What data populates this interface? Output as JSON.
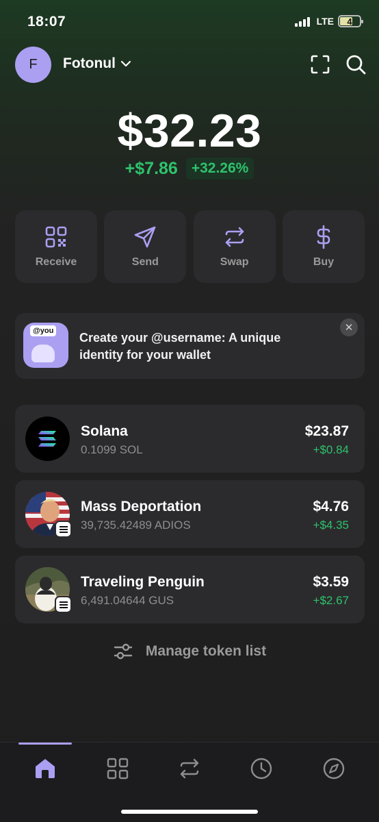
{
  "status_bar": {
    "time": "18:07",
    "network": "LTE",
    "battery": "4"
  },
  "header": {
    "avatar_letter": "F",
    "account_name": "Fotonul"
  },
  "balance": {
    "total": "$32.23",
    "change_abs": "+$7.86",
    "change_pct": "+32.26%"
  },
  "actions": [
    {
      "label": "Receive",
      "icon": "qr-code-icon"
    },
    {
      "label": "Send",
      "icon": "send-icon"
    },
    {
      "label": "Swap",
      "icon": "swap-icon"
    },
    {
      "label": "Buy",
      "icon": "dollar-icon"
    }
  ],
  "promo": {
    "tag": "@you",
    "text": "Create your @username: A unique identity for your wallet"
  },
  "tokens": [
    {
      "name": "Solana",
      "amount": "0.1099 SOL",
      "value": "$23.87",
      "change": "+$0.84"
    },
    {
      "name": "Mass Deportation",
      "amount": "39,735.42489 ADIOS",
      "value": "$4.76",
      "change": "+$4.35"
    },
    {
      "name": "Traveling Penguin",
      "amount": "6,491.04644 GUS",
      "value": "$3.59",
      "change": "+$2.67"
    }
  ],
  "manage": {
    "label": "Manage token list"
  },
  "tabs": [
    "home-icon",
    "grid-icon",
    "swap-icon",
    "history-icon",
    "explore-icon"
  ],
  "colors": {
    "accent": "#ab9ff2",
    "positive": "#2ec26c",
    "card": "#2b2b2d",
    "muted": "#9a9a9a"
  }
}
